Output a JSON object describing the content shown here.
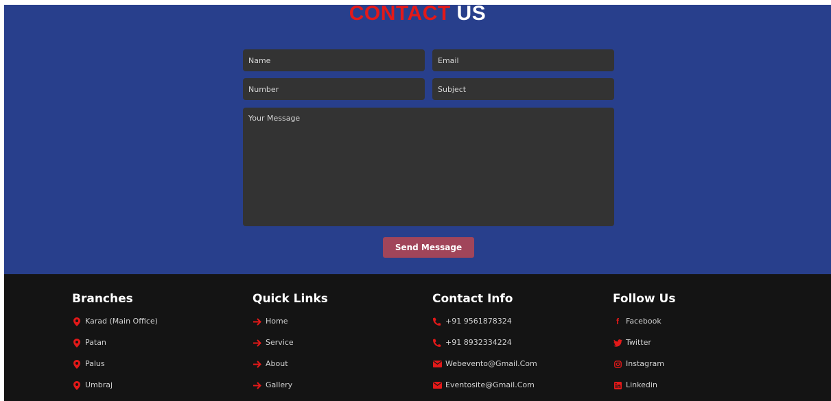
{
  "contact": {
    "title_part1": "CONTACT",
    "title_part2": "US",
    "name_placeholder": "Name",
    "email_placeholder": "Email",
    "number_placeholder": "Number",
    "subject_placeholder": "Subject",
    "message_placeholder": "Your Message",
    "send_label": "Send Message"
  },
  "footer": {
    "branches": {
      "title": "Branches",
      "icon": "map-pin-icon",
      "items": [
        "Karad (Main Office)",
        "Patan",
        "Palus",
        "Umbraj"
      ]
    },
    "quick_links": {
      "title": "Quick Links",
      "icon": "arrow-right-icon",
      "items": [
        "Home",
        "Service",
        "About",
        "Gallery"
      ]
    },
    "contact_info": {
      "title": "Contact Info",
      "items": [
        {
          "icon": "phone-icon",
          "text": "+91 9561878324"
        },
        {
          "icon": "phone-icon",
          "text": "+91 8932334224"
        },
        {
          "icon": "envelope-icon",
          "text": "Webevento@Gmail.Com"
        },
        {
          "icon": "envelope-icon",
          "text": "Eventosite@Gmail.Com"
        }
      ]
    },
    "follow_us": {
      "title": "Follow Us",
      "items": [
        {
          "icon": "facebook-icon",
          "text": "Facebook"
        },
        {
          "icon": "twitter-icon",
          "text": "Twitter"
        },
        {
          "icon": "instagram-icon",
          "text": "Instagram"
        },
        {
          "icon": "linkedin-icon",
          "text": "Linkedin"
        }
      ]
    }
  },
  "colors": {
    "accent_red": "#e31919",
    "section_blue": "#283f8c",
    "field_bg": "#333333",
    "button_bg": "#a1455a",
    "footer_bg": "#141414"
  }
}
